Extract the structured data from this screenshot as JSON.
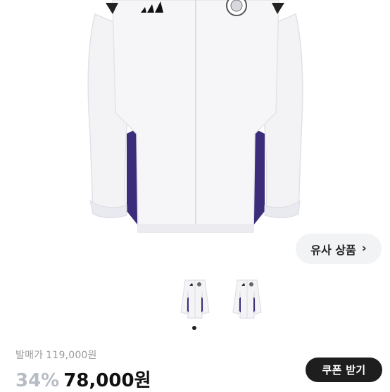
{
  "gallery": {
    "hero_alt": "white anorak jacket",
    "thumbnail_count": 2,
    "active_index": 0,
    "colors": {
      "body": "#f4f4f6",
      "panel": "#3b2d7a",
      "shadow": "#e2e3e8"
    }
  },
  "similar": {
    "label": "유사 상품",
    "chevron": "›"
  },
  "price": {
    "list_label": "발매가",
    "list_value": "119,000원",
    "discount": "34%",
    "sale_value": "78,000원"
  },
  "coupon": {
    "label": "쿠폰 받기"
  }
}
